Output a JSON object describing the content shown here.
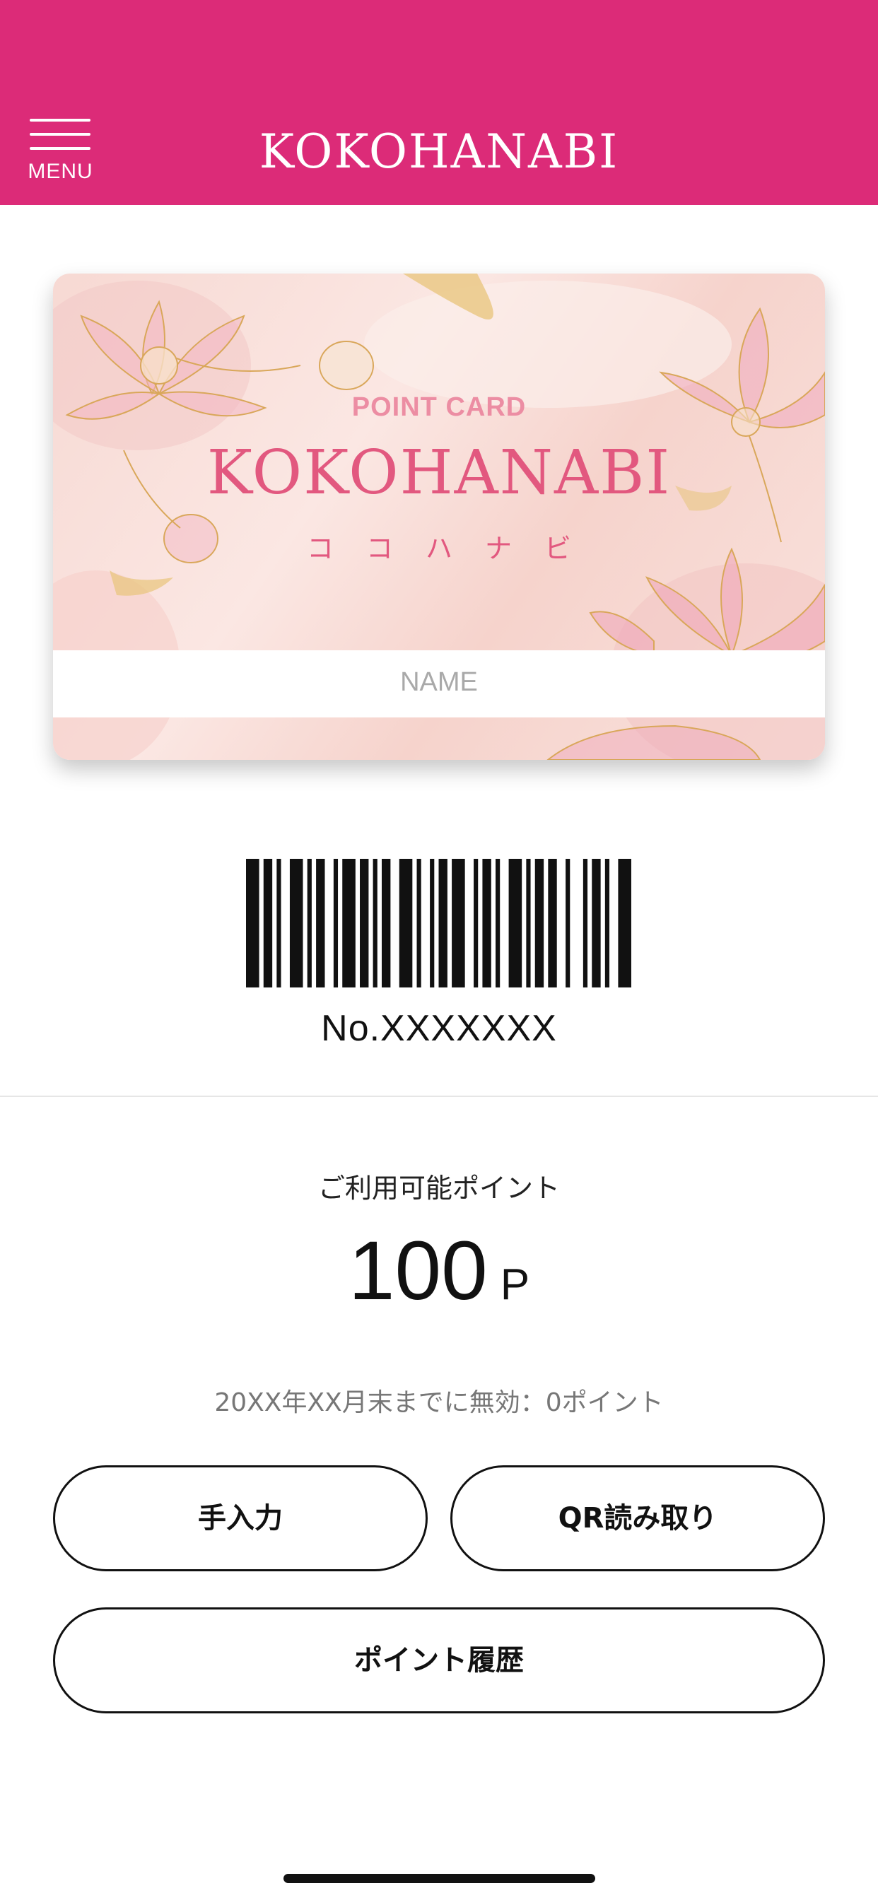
{
  "header": {
    "menu_label": "MENU",
    "brand": "KOKOHANABI",
    "background_color": "#dc2b78"
  },
  "card": {
    "subtitle": "POINT CARD",
    "title": "KOKOHANABI",
    "title_kana": "ココハナビ",
    "name_placeholder": "NAME",
    "accent_color": "#e2587f"
  },
  "barcode": {
    "card_number": "No.XXXXXXX"
  },
  "points": {
    "label": "ご利用可能ポイント",
    "value": "100",
    "unit": "P",
    "expiry_note": "20XX年XX月末までに無効：0ポイント"
  },
  "buttons": {
    "manual_input": "手入力",
    "qr_scan": "QR読み取り",
    "point_history": "ポイント履歴"
  }
}
